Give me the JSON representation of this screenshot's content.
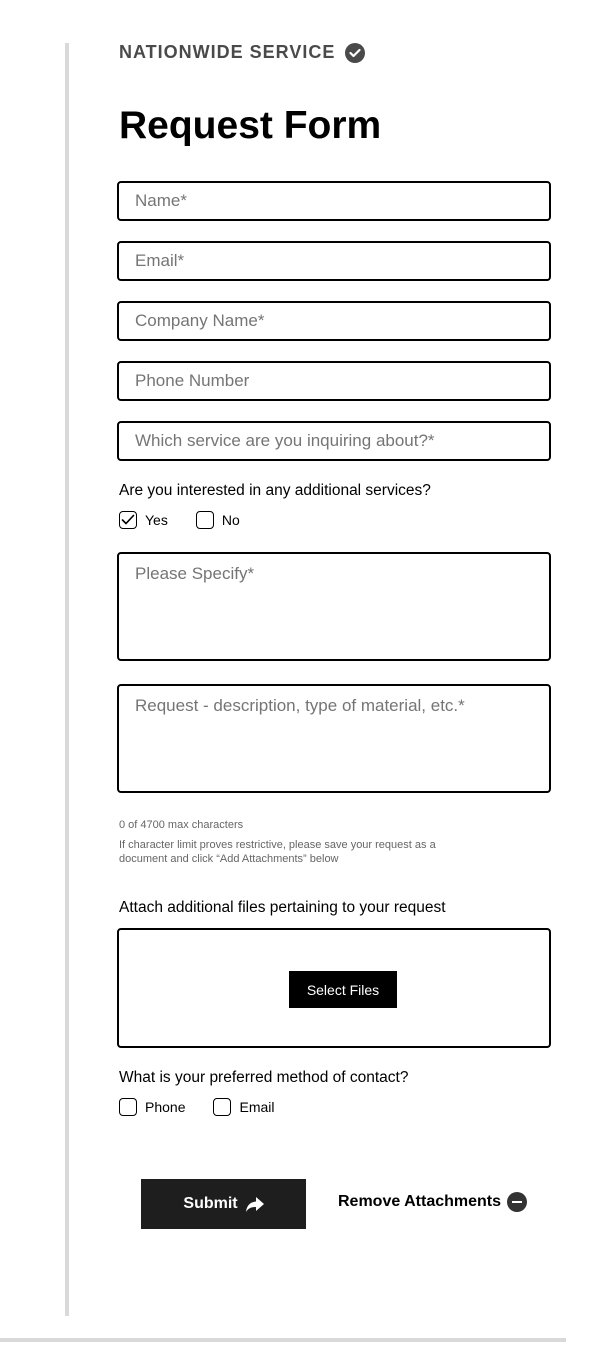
{
  "header": {
    "eyebrow": "NATIONWIDE SERVICE",
    "eyebrow_icon": "check-circle-icon",
    "title": "Request Form"
  },
  "fields": {
    "name": {
      "placeholder": "Name*",
      "value": ""
    },
    "email": {
      "placeholder": "Email*",
      "value": ""
    },
    "company": {
      "placeholder": "Company Name*",
      "value": ""
    },
    "phone": {
      "placeholder": "Phone Number",
      "value": ""
    },
    "service": {
      "placeholder": "Which service are you inquiring about?*",
      "value": ""
    },
    "specify": {
      "placeholder": "Please Specify*",
      "value": ""
    },
    "request": {
      "placeholder": "Request - description, type of material, etc.*",
      "value": ""
    }
  },
  "additional_services": {
    "question": "Are you interested in any additional services?",
    "options": [
      {
        "label": "Yes",
        "checked": true
      },
      {
        "label": "No",
        "checked": false
      }
    ]
  },
  "char_counter": "0 of 4700 max characters",
  "char_hint": "If character limit proves restrictive, please save your request as a document and click “Add Attachments” below",
  "attachments": {
    "label": "Attach additional files pertaining to your request",
    "select_button": "Select Files"
  },
  "contact_method": {
    "question": "What is your preferred method of contact?",
    "options": [
      {
        "label": "Phone",
        "checked": false
      },
      {
        "label": "Email",
        "checked": false
      }
    ]
  },
  "actions": {
    "submit": "Submit",
    "submit_icon": "share-arrow-icon",
    "remove_attachments": "Remove Attachments",
    "remove_icon": "minus-circle-icon"
  },
  "colors": {
    "accent_dark": "#1e1e1e",
    "eyebrow": "#4a4a4a",
    "divider": "#d9d9d9",
    "placeholder": "#757575"
  }
}
